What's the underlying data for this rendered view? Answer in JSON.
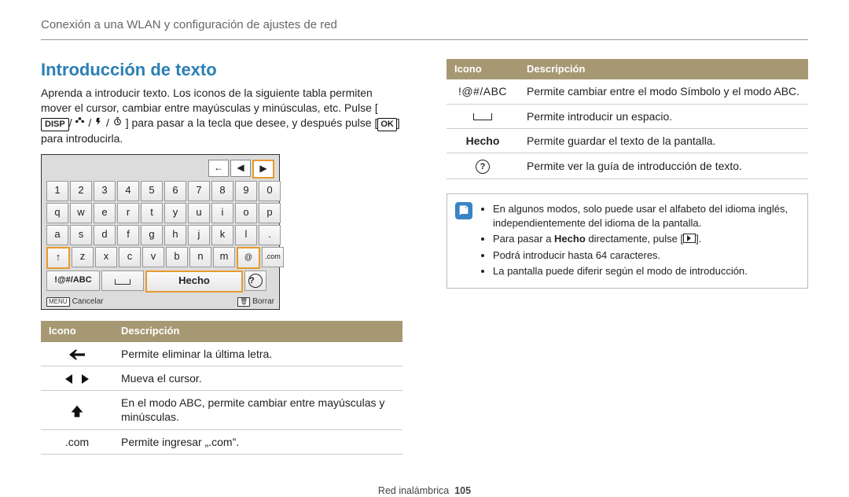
{
  "breadcrumb": "Conexión a una WLAN y configuración de ajustes de red",
  "section_title": "Introducción de texto",
  "intro": {
    "line1": "Aprenda a introducir texto. Los iconos de la siguiente tabla permiten mover el cursor, cambiar entre mayúsculas y minúsculas, etc. Pulse [",
    "disp": "DISP",
    "sep1": "/",
    "sep2": "/",
    "sep3": "/",
    "line2": "] para pasar a la tecla que desee, y después pulse [",
    "ok": "OK",
    "line3": "] para introducirla."
  },
  "keyboard": {
    "top": {
      "back": "←",
      "left": "◀",
      "right": "▶"
    },
    "row1": [
      "1",
      "2",
      "3",
      "4",
      "5",
      "6",
      "7",
      "8",
      "9",
      "0"
    ],
    "row2": [
      "q",
      "w",
      "e",
      "r",
      "t",
      "y",
      "u",
      "i",
      "o",
      "p"
    ],
    "row3": [
      "a",
      "s",
      "d",
      "f",
      "g",
      "h",
      "j",
      "k",
      "l",
      "."
    ],
    "row4_shift": "↑",
    "row4": [
      "z",
      "x",
      "c",
      "v",
      "b",
      "n",
      "m"
    ],
    "row4_at": "@",
    "row4_com": ".com",
    "bottom": {
      "mode": "!@#/ABC",
      "hecho": "Hecho",
      "help": "?"
    },
    "footer_left": "Cancelar",
    "footer_left_btn": "MENU",
    "footer_right": "Borrar",
    "footer_right_btn": "🗑"
  },
  "table1": {
    "h1": "Icono",
    "h2": "Descripción",
    "rows": [
      {
        "desc": "Permite eliminar la última letra."
      },
      {
        "desc": "Mueva el cursor."
      },
      {
        "desc": "En el modo ABC, permite cambiar entre mayúsculas y minúsculas."
      },
      {
        "icon_text": ".com",
        "desc": "Permite ingresar „.com”."
      }
    ]
  },
  "table2": {
    "h1": "Icono",
    "h2": "Descripción",
    "rows": [
      {
        "icon_text": "!@#/ABC",
        "desc": "Permite cambiar entre el modo Símbolo y el modo ABC."
      },
      {
        "desc": "Permite introducir un espacio."
      },
      {
        "icon_text": "Hecho",
        "desc": "Permite guardar el texto de la pantalla."
      },
      {
        "desc": "Permite ver la guía de introducción de texto."
      }
    ]
  },
  "note": {
    "items": [
      "En algunos modos, solo puede usar el alfabeto del idioma inglés, independientemente del idioma de la pantalla.",
      "Para pasar a Hecho directamente, pulse [",
      "Podrá introducir hasta 64 caracteres.",
      "La pantalla puede diferir según el modo de introducción."
    ],
    "item2_suffix": "].",
    "item2_bold": "Hecho"
  },
  "footer": {
    "section": "Red inalámbrica",
    "page": "105"
  }
}
